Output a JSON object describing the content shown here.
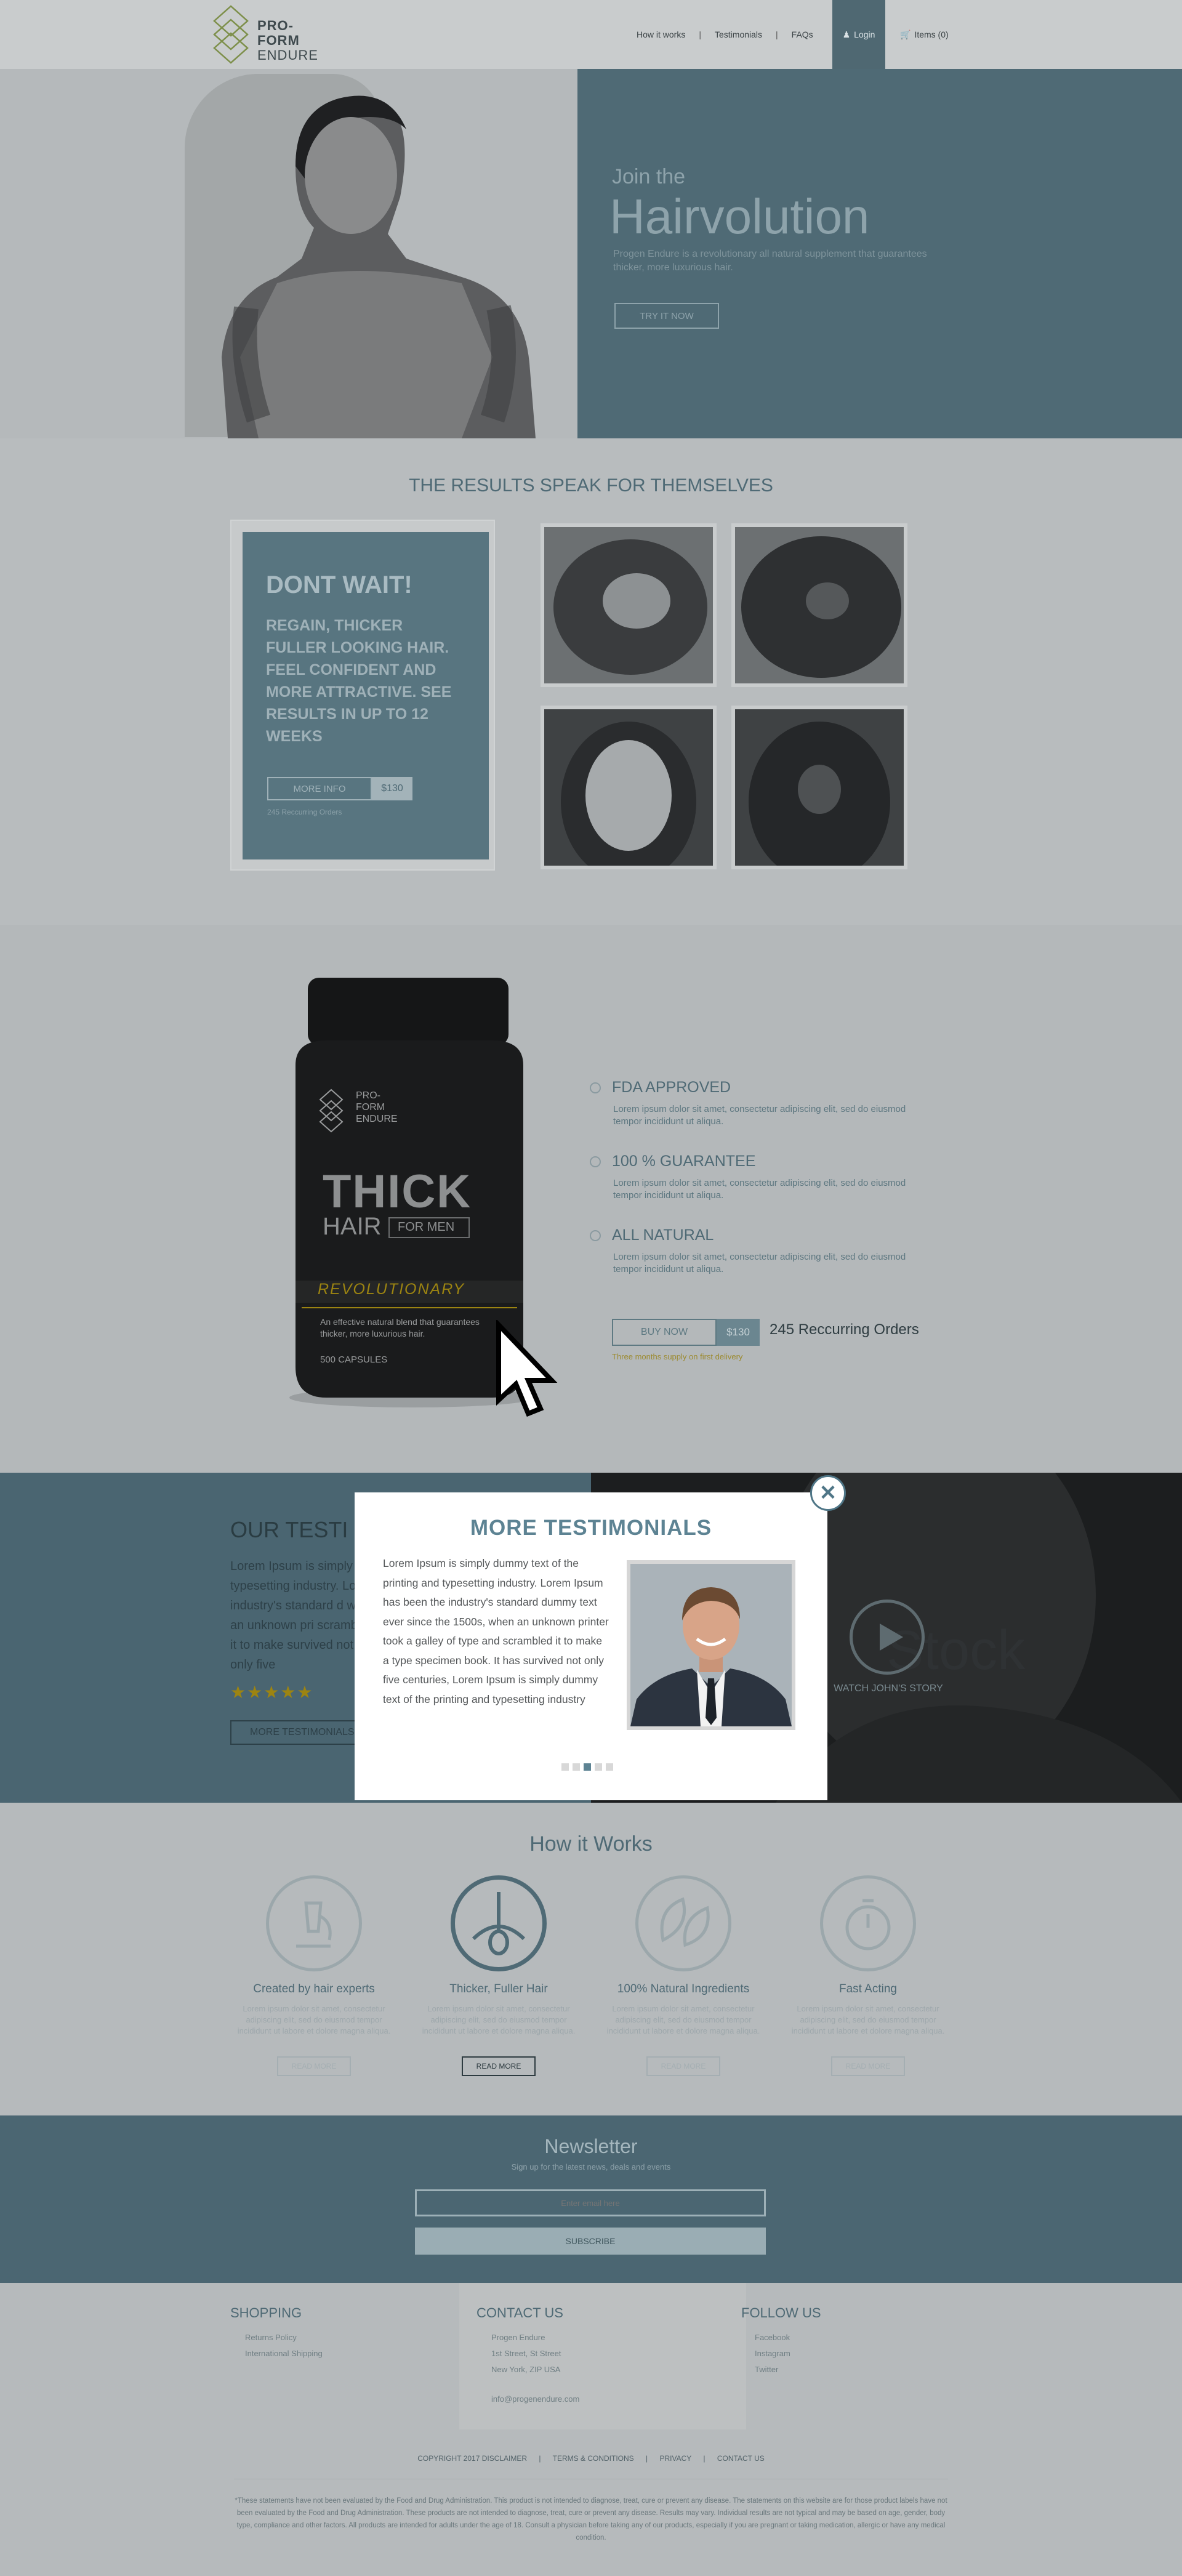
{
  "header": {
    "logo": {
      "line1": "PRO-",
      "line2": "FORM",
      "line3": "ENDURE"
    },
    "nav": [
      "How it works",
      "Testimonials",
      "FAQs"
    ],
    "login": "Login",
    "cart": "Items (0)"
  },
  "hero": {
    "kicker": "Join the",
    "title": "Hairvolution",
    "description": "Progen Endure is a revolutionary all natural supplement that guarantees thicker, more luxurious hair.",
    "cta": "TRY IT NOW"
  },
  "results": {
    "title": "THE RESULTS SPEAK FOR THEMSELVES",
    "promo": {
      "title": "DONT WAIT!",
      "text": "REGAIN, THICKER FULLER LOOKING HAIR. FEEL CONFIDENT AND MORE ATTRACTIVE. SEE RESULTS IN UP TO 12 WEEKS",
      "more_button": "MORE INFO",
      "price": "$130",
      "note": "245 Reccurring Orders"
    }
  },
  "product": {
    "bottle": {
      "brand1": "PRO-",
      "brand2": "FORM",
      "brand3": "ENDURE",
      "headline1": "THICK",
      "headline2": "HAIR",
      "headline3": "FOR MEN",
      "banner": "REVOLUTIONARY",
      "blurb": "An effective natural blend that guarantees thicker, more luxurious hair.",
      "capsules": "500 CAPSULES"
    },
    "features": [
      {
        "title": "FDA APPROVED",
        "text": "Lorem ipsum dolor sit amet, consectetur adipiscing elit, sed do eiusmod tempor incididunt ut aliqua."
      },
      {
        "title": "100 % GUARANTEE",
        "text": "Lorem ipsum dolor sit amet, consectetur adipiscing elit, sed do eiusmod tempor incididunt ut aliqua."
      },
      {
        "title": "ALL NATURAL",
        "text": "Lorem ipsum dolor sit amet, consectetur adipiscing elit, sed do eiusmod tempor incididunt ut aliqua."
      }
    ],
    "buy_button": "BUY NOW",
    "price": "$130",
    "orders": "245 Reccurring Orders",
    "note": "Three months supply on first delivery"
  },
  "testimonials": {
    "title": "OUR  TESTI",
    "text": "Lorem Ipsum is simply typesetting industry. Lo industry's standard d when an unknown pri scrambled it to make survived not only five",
    "stars": "★★★★★",
    "more_button": "MORE TESTIMONIALS",
    "video_caption": "WATCH JOHN'S STORY",
    "video_watermark": "Stock"
  },
  "modal": {
    "title": "MORE  TESTIMONIALS",
    "text": "Lorem Ipsum is simply dummy text of the printing and typesetting industry. Lorem Ipsum has been the industry's standard dummy text ever since the 1500s, when an unknown printer took a galley of type and scrambled it to make a type specimen book. It has survived not only five centuries, Lorem Ipsum is simply dummy text of the printing and typesetting industry",
    "close": "✕",
    "dots": 5,
    "active_dot": 3
  },
  "how": {
    "title": "How it Works",
    "items": [
      {
        "label": "Created by hair experts",
        "text": "Lorem ipsum dolor sit amet, consectetur adipiscing elit, sed do eiusmod tempor incididunt ut labore et dolore magna aliqua.",
        "button": "READ MORE",
        "icon": "microscope-icon"
      },
      {
        "label": "Thicker, Fuller Hair",
        "text": "Lorem ipsum dolor sit amet, consectetur adipiscing elit, sed do eiusmod tempor incididunt ut labore et dolore magna aliqua.",
        "button": "READ MORE",
        "icon": "hair-follicle-icon"
      },
      {
        "label": "100% Natural Ingredients",
        "text": "Lorem ipsum dolor sit amet, consectetur adipiscing elit, sed do eiusmod tempor incididunt ut labore et dolore magna aliqua.",
        "button": "READ MORE",
        "icon": "leaves-icon"
      },
      {
        "label": "Fast Acting",
        "text": "Lorem ipsum dolor sit amet, consectetur adipiscing elit, sed do eiusmod tempor incididunt ut labore et dolore magna aliqua.",
        "button": "READ MORE",
        "icon": "stopwatch-icon"
      }
    ]
  },
  "newsletter": {
    "title": "Newsletter",
    "subtitle": "Sign up for the latest news, deals and events",
    "placeholder": "Enter email here",
    "button": "SUBSCRIBE"
  },
  "footer": {
    "shopping": {
      "title": "SHOPPING",
      "items": [
        "Returns Policy",
        "International Shipping"
      ]
    },
    "contact": {
      "title": "CONTACT US",
      "items": [
        "Progen Endure",
        "1st Street, St Street",
        "New York, ZIP USA",
        "info@progenendure.com"
      ]
    },
    "follow": {
      "title": "FOLLOW US",
      "items": [
        "Facebook",
        "Instagram",
        "Twitter"
      ]
    },
    "links": [
      "COPYRIGHT 2017 DISCLAIMER",
      "TERMS & CONDITIONS",
      "PRIVACY",
      "CONTACT US"
    ],
    "disclaimer": "*These statements have not been evaluated by the Food and Drug Administration. This product is not intended to diagnose, treat, cure or prevent any disease. The statements on this website are for those product labels have not been evaluated by the Food and Drug Administration. These products are not intended to diagnose, treat, cure or prevent any disease. Results may vary. Individual results are not typical and may be based on age, gender, body type, compliance and other factors. All products are intended for adults under the age of 18. Consult a physician before taking any of our products, especially if you are pregnant or taking medication, allergic or have any medical condition."
  },
  "colors": {
    "accent": "#4f6a75",
    "modal_title": "#5d8393",
    "stars": "#9d8411"
  }
}
